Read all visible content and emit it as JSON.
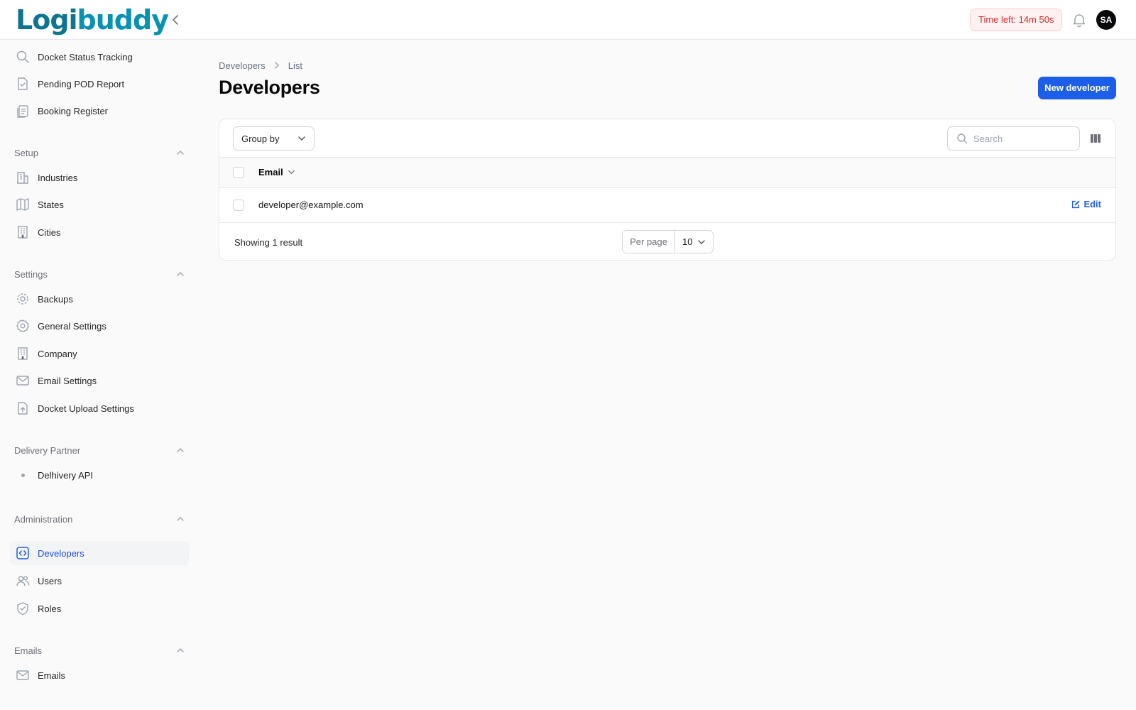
{
  "brand": {
    "logo_part1": "Logi",
    "logo_part2": "buddy"
  },
  "header": {
    "timer_label": "Time left: 14m 50s",
    "avatar_initials": "SA"
  },
  "sidebar": {
    "top_items": [
      {
        "label": "Docket Status Tracking",
        "icon": "search-icon"
      },
      {
        "label": "Pending POD Report",
        "icon": "document-check-icon"
      },
      {
        "label": "Booking Register",
        "icon": "clipboard-list-icon"
      }
    ],
    "groups": [
      {
        "label": "Setup",
        "items": [
          {
            "label": "Industries",
            "icon": "building-office-icon"
          },
          {
            "label": "States",
            "icon": "map-icon"
          },
          {
            "label": "Cities",
            "icon": "building-icon"
          }
        ]
      },
      {
        "label": "Settings",
        "items": [
          {
            "label": "Backups",
            "icon": "cog-spin-icon"
          },
          {
            "label": "General Settings",
            "icon": "gear-icon"
          },
          {
            "label": "Company",
            "icon": "building-icon"
          },
          {
            "label": "Email Settings",
            "icon": "envelope-icon"
          },
          {
            "label": "Docket Upload Settings",
            "icon": "document-upload-icon"
          }
        ]
      },
      {
        "label": "Delivery Partner",
        "items": [
          {
            "label": "Delhivery API",
            "icon": "dot-icon"
          }
        ]
      },
      {
        "label": "Administration",
        "items": [
          {
            "label": "Developers",
            "icon": "code-bracket-icon",
            "active": true
          },
          {
            "label": "Users",
            "icon": "users-icon"
          },
          {
            "label": "Roles",
            "icon": "shield-check-icon"
          }
        ]
      },
      {
        "label": "Emails",
        "items": [
          {
            "label": "Emails",
            "icon": "envelope-icon"
          }
        ]
      }
    ]
  },
  "main": {
    "breadcrumb": [
      "Developers",
      "List"
    ],
    "title": "Developers",
    "new_button_label": "New developer",
    "toolbar": {
      "group_by_label": "Group by",
      "search_placeholder": "Search"
    },
    "table": {
      "columns": [
        "Email"
      ],
      "rows": [
        {
          "email": "developer@example.com",
          "action_label": "Edit"
        }
      ]
    },
    "footer": {
      "showing_text": "Showing 1 result",
      "per_page_label": "Per page",
      "per_page_value": "10"
    }
  },
  "colors": {
    "accent": "#1d5ee8",
    "timer_text": "#dc2626",
    "timer_bg": "#fef2f2"
  }
}
